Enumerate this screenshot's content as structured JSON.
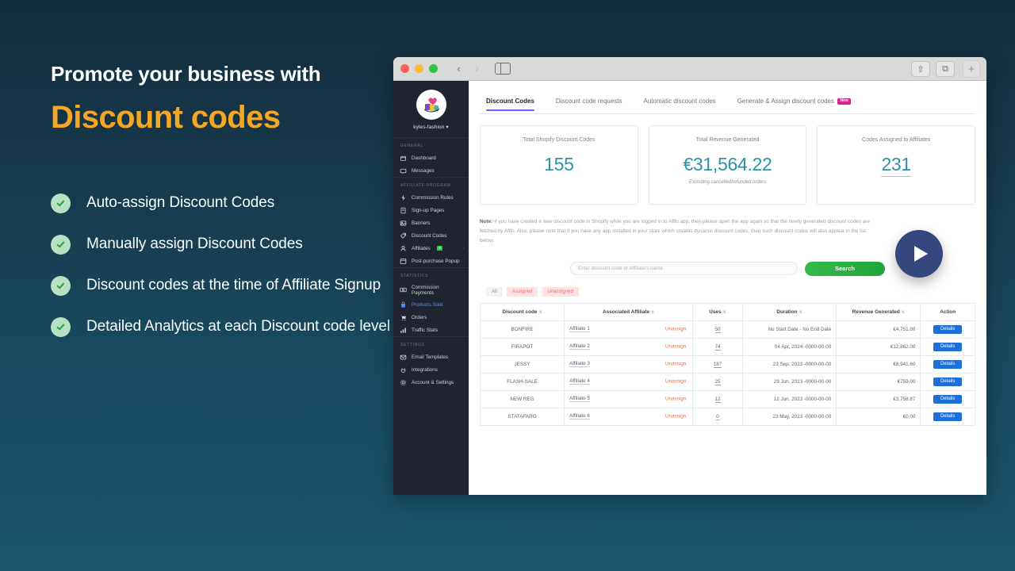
{
  "promo": {
    "kicker": "Promote your business with",
    "title": "Discount codes",
    "accent_color": "#f5a623",
    "features": [
      "Auto-assign Discount Codes",
      "Manually assign Discount Codes",
      "Discount codes at the time of Affiliate Signup",
      "Detailed Analytics at each Discount code level"
    ]
  },
  "browser": {
    "back_icon": "‹",
    "forward_icon": "›",
    "share_icon": "⇧",
    "tabs_icon": "⧉",
    "new_tab_icon": "+"
  },
  "app": {
    "store": {
      "name": "kyles-fashion ▾"
    },
    "sidebar": [
      {
        "section": "GENERAL",
        "items": [
          {
            "label": "Dashboard",
            "icon": "dashboard-icon",
            "active": false
          },
          {
            "label": "Messages",
            "icon": "messages-icon",
            "active": false
          }
        ]
      },
      {
        "section": "AFFILIATE PROGRAM",
        "items": [
          {
            "label": "Commission Rules",
            "icon": "bolt-icon",
            "active": false
          },
          {
            "label": "Sign-up Pages",
            "icon": "page-icon",
            "active": false
          },
          {
            "label": "Banners",
            "icon": "image-icon",
            "active": false
          },
          {
            "label": "Discount Codes",
            "icon": "tag-icon",
            "active": false
          },
          {
            "label": "Affiliates",
            "icon": "users-icon",
            "active": false,
            "badge": "5",
            "caret": "›"
          },
          {
            "label": "Post-purchase Popup",
            "icon": "popup-icon",
            "active": false
          }
        ]
      },
      {
        "section": "STATISTICS",
        "items": [
          {
            "label": "Commission Payments",
            "icon": "money-icon",
            "active": false
          },
          {
            "label": "Products Sold",
            "icon": "bag-icon",
            "active": true
          },
          {
            "label": "Orders",
            "icon": "cart-icon",
            "active": false
          },
          {
            "label": "Traffic Stats",
            "icon": "chart-icon",
            "active": false
          }
        ]
      },
      {
        "section": "SETTINGS",
        "items": [
          {
            "label": "Email Templates",
            "icon": "mail-icon",
            "active": false
          },
          {
            "label": "Integrations",
            "icon": "plug-icon",
            "active": false
          },
          {
            "label": "Account & Settings",
            "icon": "gear-icon",
            "active": false
          }
        ]
      }
    ],
    "tabs": [
      {
        "label": "Discount Codes",
        "active": true
      },
      {
        "label": "Discount code requests",
        "active": false
      },
      {
        "label": "Automatic discount codes",
        "active": false
      },
      {
        "label": "Generate & Assign discount codes",
        "active": false,
        "badge": "New"
      }
    ],
    "stats": [
      {
        "label": "Total Shopify Discount Codes",
        "value": "155",
        "sub": "",
        "underline": false
      },
      {
        "label": "Total Revenue Generated",
        "value": "€31,564.22",
        "sub": "Excluding cancelled/refunded orders",
        "underline": false
      },
      {
        "label": "Codes Assigned to Affiliates",
        "value": "231",
        "sub": "",
        "underline": true
      }
    ],
    "note": {
      "prefix": "Note:",
      "text": " If you have created a new discount code in Shopify while you are logged in to Afflo app, then please open the app again so that the newly generated discount codes are fetched by Afflo. Also, please note that if you have any app installed in your store which creates dynamic discount codes, then such discount codes will also appear in the list below."
    },
    "search": {
      "placeholder": "Enter discount code or Affiliate's name",
      "value": "",
      "button_label": "Search"
    },
    "filters": [
      {
        "label": "All",
        "style": "neutral"
      },
      {
        "label": "Assigned",
        "style": "pink"
      },
      {
        "label": "Unassigned",
        "style": "pink"
      }
    ],
    "table": {
      "columns": [
        "Discount code",
        "Associated Affiliate",
        "Uses",
        "Duration",
        "Revenue Generated",
        "Action"
      ],
      "sortable": [
        true,
        true,
        true,
        true,
        true,
        false
      ],
      "action_label": "Details",
      "unassign_label": "Unassign",
      "rows": [
        {
          "code": "BONFIRE",
          "affiliate": "Affiliate 1",
          "uses": "50",
          "duration": "No Start Date - No End Date",
          "revenue": "€4,751.00"
        },
        {
          "code": "FIRAPOT",
          "affiliate": "Affiliate 2",
          "uses": "74",
          "duration": "04 Apr, 2024 -0000-00-00",
          "revenue": "€12,862.00"
        },
        {
          "code": "JESSY",
          "affiliate": "Affiliate 3",
          "uses": "187",
          "duration": "23 Sep, 2023 -0000-00-00",
          "revenue": "€8,941.60"
        },
        {
          "code": "FLASH-SALE",
          "affiliate": "Affiliate 4",
          "uses": "25",
          "duration": "29 Jun, 2023 -0000-00-00",
          "revenue": "€759.00"
        },
        {
          "code": "NEW REG",
          "affiliate": "Affiliate 5",
          "uses": "12",
          "duration": "12 Jun, 2023 -0000-00-00",
          "revenue": "€3,758.87"
        },
        {
          "code": "STATAFARO",
          "affiliate": "Affiliate 6",
          "uses": "0",
          "duration": "23 May, 2023 -0000-00-00",
          "revenue": "€0.00"
        }
      ]
    }
  },
  "play_overlay": {
    "label": "play-video"
  }
}
